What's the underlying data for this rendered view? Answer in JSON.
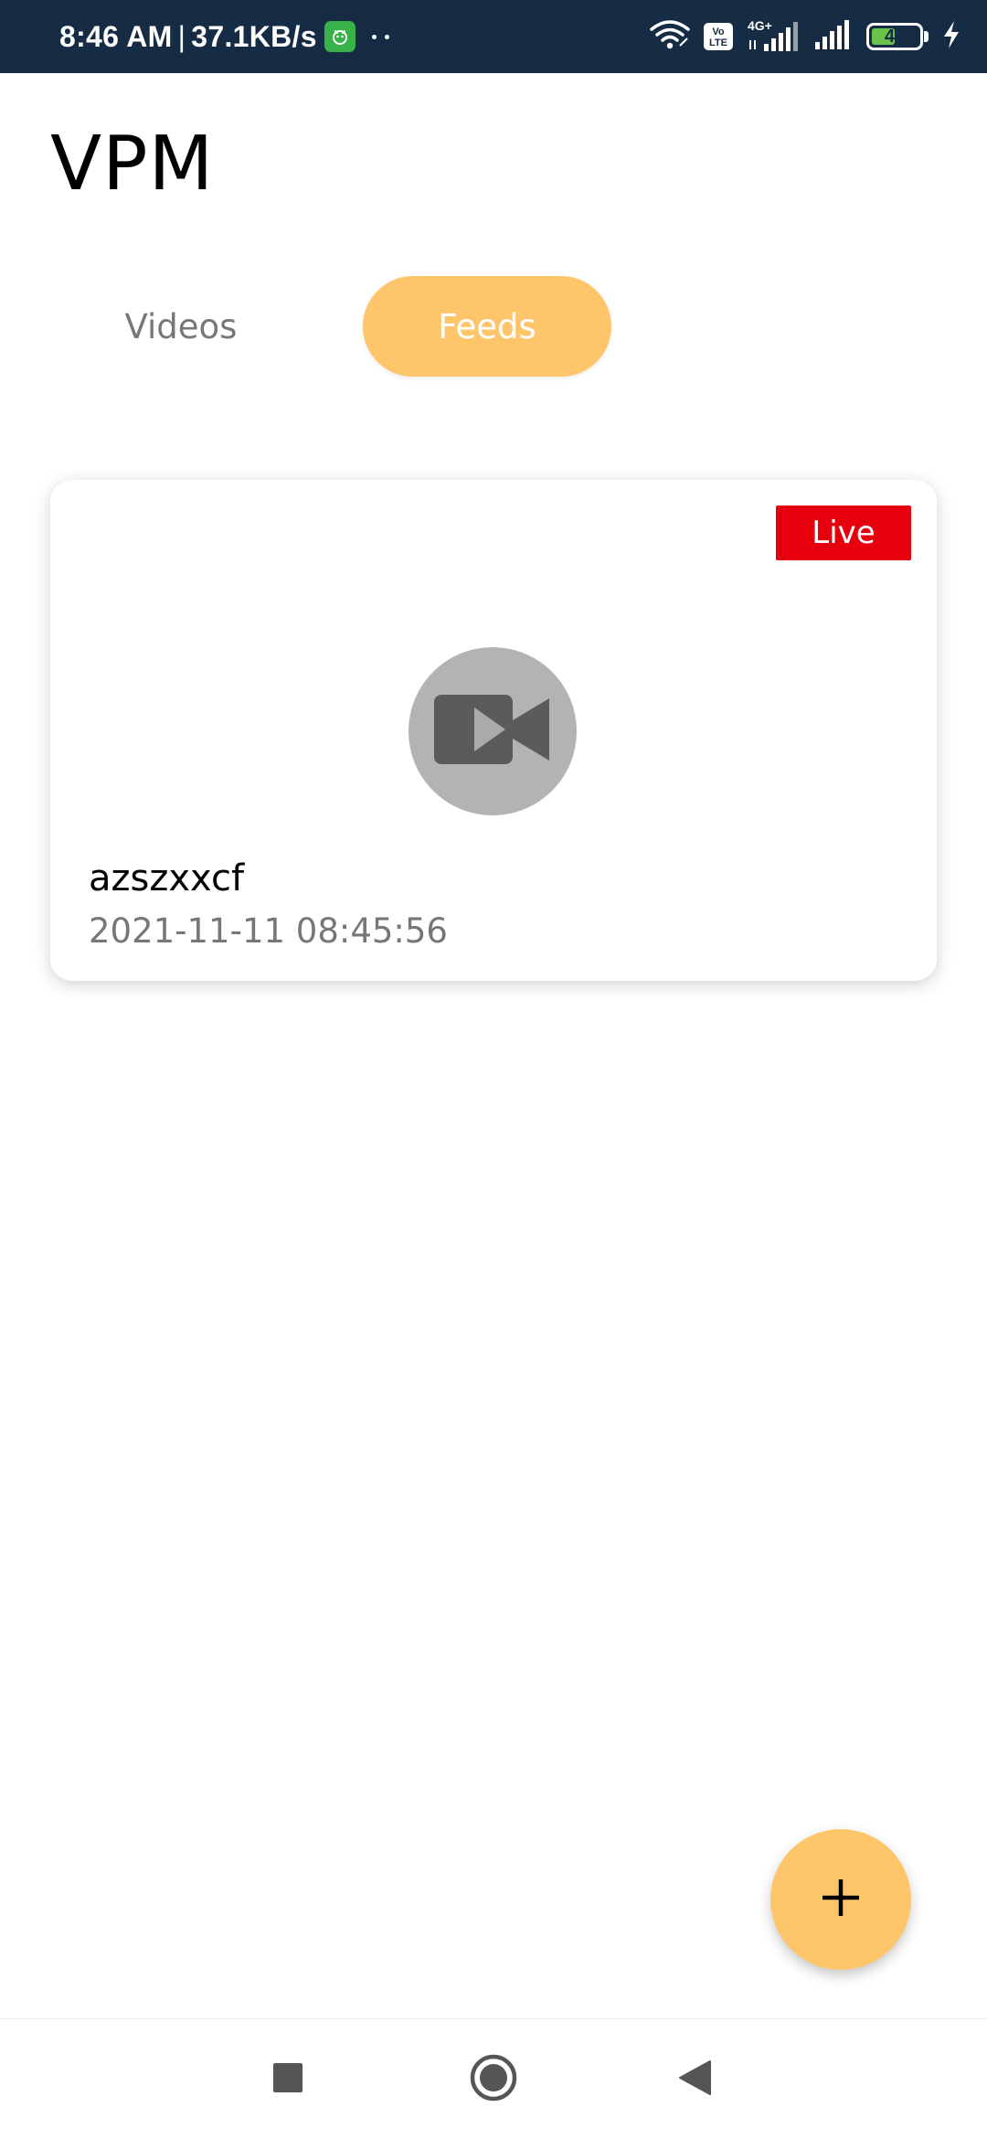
{
  "status_bar": {
    "time": "8:46 AM",
    "separator": "|",
    "network_speed": "37.1KB/s",
    "volte_label_top": "Vo",
    "volte_label_bottom": "LTE",
    "network_type": "4G+",
    "battery_level": "49",
    "battery_fraction": 0.49,
    "icons": [
      "notification-app-icon",
      "more-dots-icon",
      "wifi-icon",
      "volte-icon",
      "cell-signal-icon",
      "cell-signal-icon",
      "battery-icon",
      "charging-bolt-icon"
    ]
  },
  "app": {
    "title": "VPM"
  },
  "tabs": [
    {
      "label": "Videos",
      "selected": false
    },
    {
      "label": "Feeds",
      "selected": true
    }
  ],
  "feeds": [
    {
      "badge": "Live",
      "name": "azszxxcf",
      "timestamp": "2021-11-11 08:45:56",
      "thumbnail_icon": "video-camera-icon"
    }
  ],
  "fab": {
    "icon": "plus-icon"
  },
  "nav": {
    "icons": [
      "recents-square-icon",
      "home-circle-icon",
      "back-triangle-icon"
    ]
  },
  "colors": {
    "status_bar": "#152c44",
    "accent": "#ffc56b",
    "live_badge": "#e6000e",
    "thumbnail_circle": "#b3b3b3",
    "muted_text": "#777777"
  }
}
